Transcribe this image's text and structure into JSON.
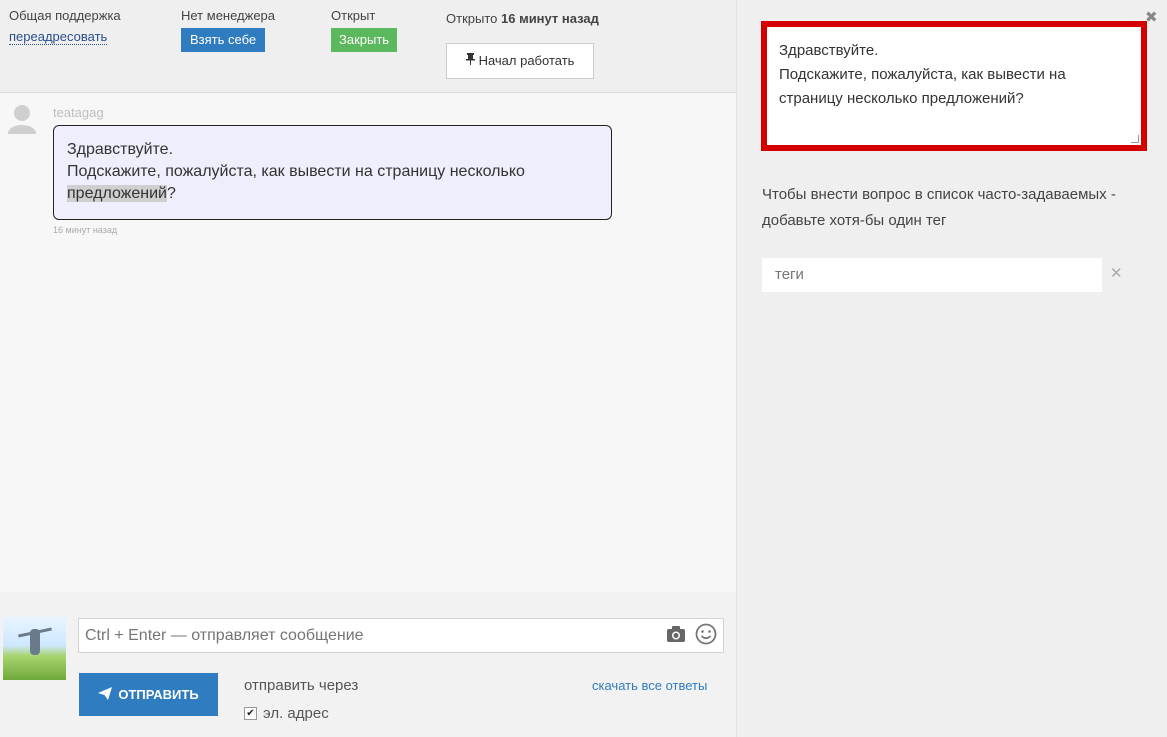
{
  "topbar": {
    "group_label": "Общая поддержка",
    "redirect_link": "переадресовать",
    "manager_label": "Нет менеджера",
    "take_button": "Взять себе",
    "status_label": "Открыт",
    "close_button": "Закрыть",
    "opened_prefix": "Открыто",
    "opened_time": "16 минут назад",
    "start_work_button": "Начал работать"
  },
  "chat": {
    "username": "teatagag",
    "message_line1": "Здравствуйте.",
    "message_line2": "Подскажите, пожалуйста, как вывести на страницу несколько",
    "message_highlight": "предложений",
    "message_tail": "?",
    "message_time": "16 минут назад"
  },
  "composer": {
    "input_placeholder": "Ctrl + Enter — отправляет сообщение",
    "send_button": "ОТПРАВИТЬ",
    "send_via_label": "отправить через",
    "download_link": "скачать все ответы",
    "email_checkbox_label": "эл. адрес",
    "email_checked": true
  },
  "right_panel": {
    "answer_line1": "Здравствуйте.",
    "answer_line2": "Подскажите, пожалуйста, как вывести на страницу несколько предложений?",
    "faq_hint": "Чтобы внести вопрос в список часто-задаваемых - добавьте хотя-бы один тег",
    "tags_placeholder": "теги",
    "close_symbol": "✖",
    "clear_symbol": "✕"
  },
  "colors": {
    "accent_blue": "#2f7cc0",
    "accent_green": "#5cb85c",
    "highlight_red": "#d40000"
  }
}
